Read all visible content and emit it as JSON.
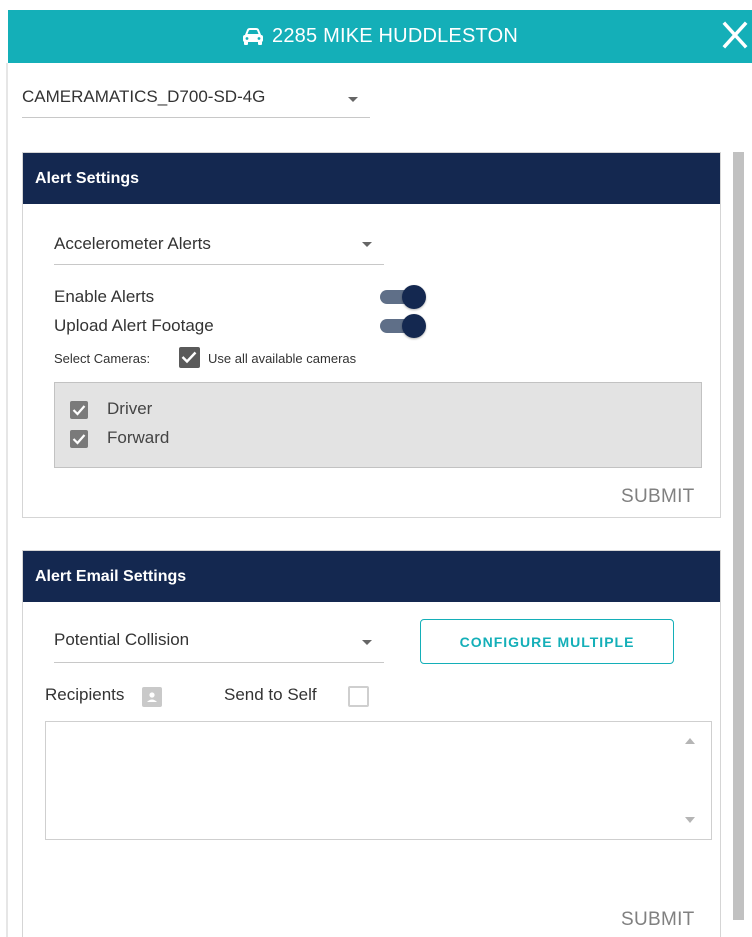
{
  "header": {
    "title": "2285 MIKE HUDDLESTON",
    "vehicle_icon": "car-icon",
    "close_icon": "close-icon",
    "color": "#14afb8"
  },
  "device": {
    "selected": "CAMERAMATICS_D700-SD-4G"
  },
  "alert_settings": {
    "title": "Alert Settings",
    "alert_type": "Accelerometer Alerts",
    "enable_alerts_label": "Enable Alerts",
    "enable_alerts_on": true,
    "upload_footage_label": "Upload Alert Footage",
    "upload_footage_on": true,
    "select_cameras_label": "Select Cameras:",
    "use_all_label": "Use all available cameras",
    "use_all_checked": true,
    "cameras": [
      {
        "label": "Driver",
        "checked": true
      },
      {
        "label": "Forward",
        "checked": true
      }
    ],
    "submit_label": "SUBMIT"
  },
  "alert_email_settings": {
    "title": "Alert Email Settings",
    "alert_type": "Potential Collision",
    "configure_label": "CONFIGURE MULTIPLE",
    "recipients_label": "Recipients",
    "send_to_self_label": "Send to Self",
    "send_to_self_checked": false,
    "recipients_value": "",
    "submit_label": "SUBMIT"
  },
  "colors": {
    "teal": "#14afb8",
    "navy": "#142850",
    "toggle_track": "#5f6f88"
  }
}
